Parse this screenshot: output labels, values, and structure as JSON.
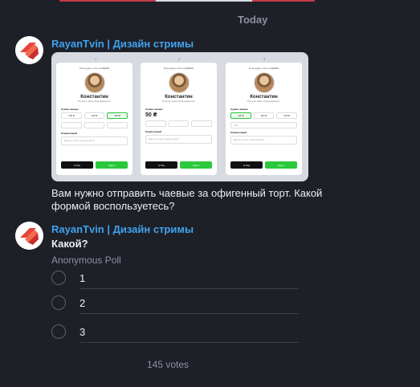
{
  "date_separator": "Today",
  "messages": [
    {
      "sender": "RayanTvin | Дизайн стримы",
      "text": "Вам нужно отправить чаевые за офигенный торт. Какой формой воспользуетесь?"
    },
    {
      "sender": "RayanTvin | Дизайн стримы"
    }
  ],
  "poll": {
    "question": "Какой?",
    "type": "Anonymous Poll",
    "options": [
      "1",
      "2",
      "3"
    ],
    "votes": "145 votes"
  },
  "mockup": {
    "slides": [
      "1",
      "2",
      "3"
    ],
    "caption": "Благодарю тебе за ₽₽₽₽₽",
    "name": "Константин",
    "subtitle": "Получит ваше благодарность",
    "amount_label": "Сумма чаевых",
    "chips": [
      "100 ₴",
      "200 ₴",
      "300 ₴"
    ],
    "amount_big": "50 ₴",
    "comment_label": "Комментарий",
    "comment_placeholder": "Введите ваш комментарий",
    "gpay": "G Pay",
    "go": "Карта",
    "other_label": "Иначе",
    "other_value": "100"
  },
  "colors": {
    "background": "#1e2028",
    "accent_link": "#3fa3ef",
    "secondary_text": "#8c92a0",
    "avatar_red": "#e8433a",
    "pay_green": "#2ac93c"
  }
}
